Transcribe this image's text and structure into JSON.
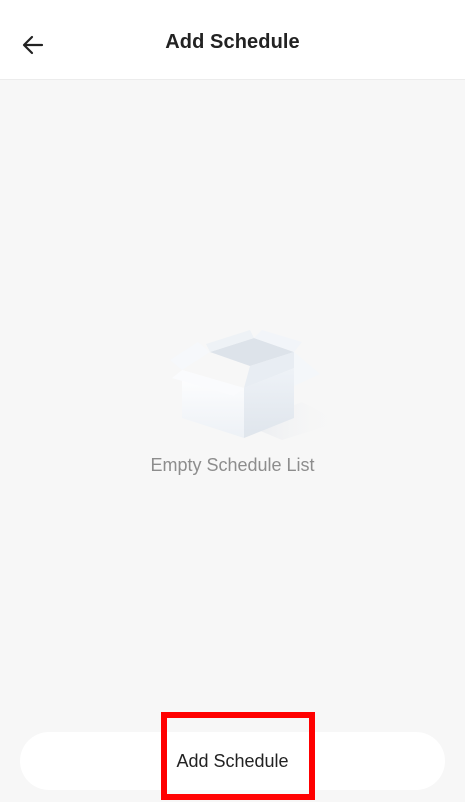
{
  "header": {
    "title": "Add Schedule",
    "back_icon": "arrow-left-icon"
  },
  "empty_state": {
    "icon": "empty-box-icon",
    "message": "Empty Schedule List"
  },
  "footer": {
    "add_button_label": "Add Schedule"
  },
  "colors": {
    "highlight": "#ff0000",
    "background": "#f7f7f7",
    "title_text": "#222222",
    "muted_text": "#8d8d8d"
  }
}
